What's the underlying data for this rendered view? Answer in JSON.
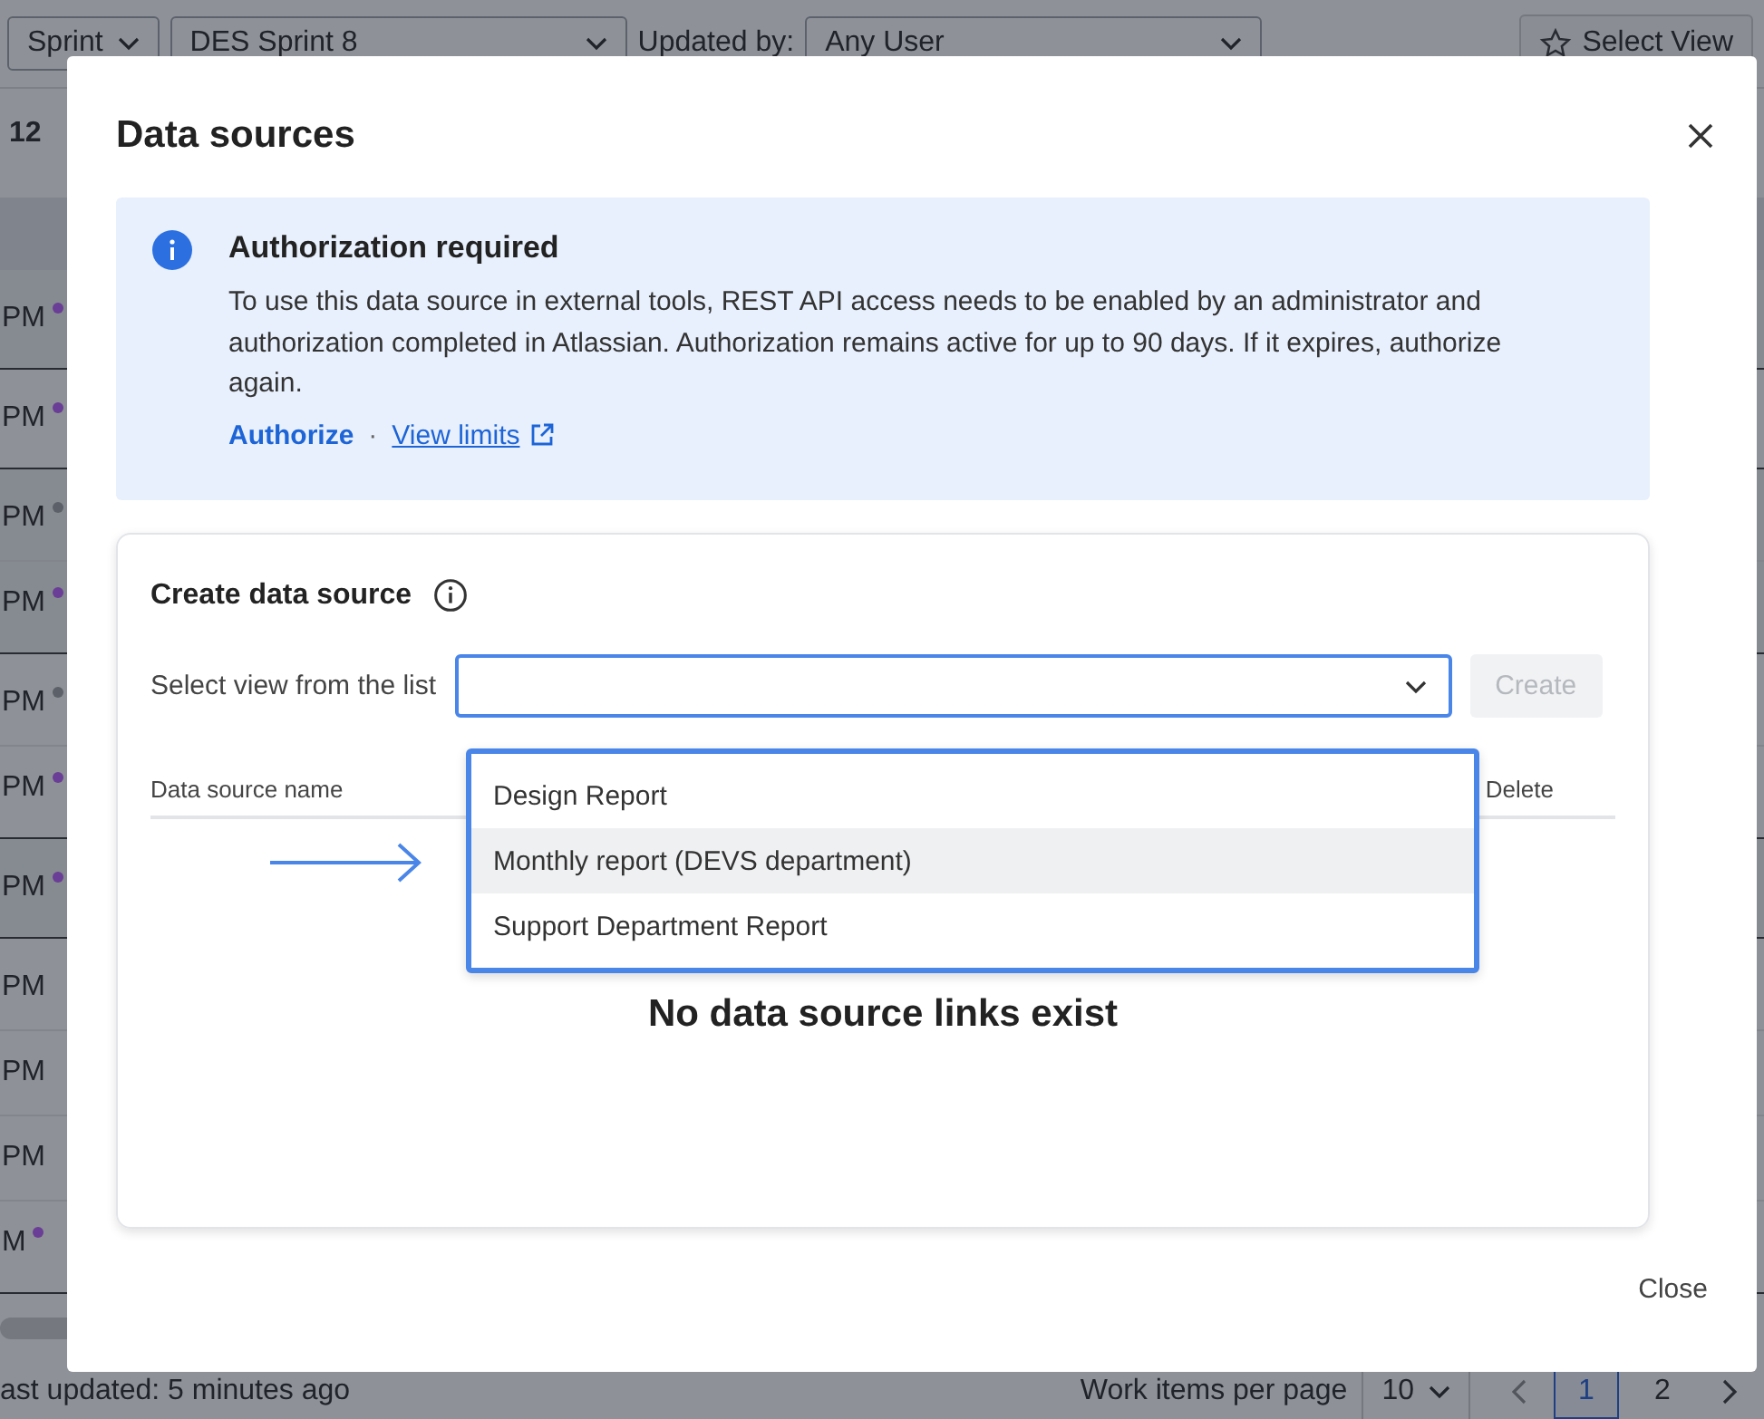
{
  "toolbar": {
    "sprint_filter": "Sprint",
    "sprint_value": "DES Sprint 8",
    "updated_by_label": "Updated by:",
    "updated_by_value": "Any User",
    "select_view_button": "Select View"
  },
  "summary": {
    "count_text": "12"
  },
  "row_groups": [
    {
      "rows": [
        {
          "time": "PM",
          "color": "#6a3d96"
        }
      ]
    },
    {
      "rows": [
        {
          "time": "PM",
          "color": "#6a3d96"
        }
      ]
    },
    {
      "rows": [
        {
          "time": "PM",
          "color": "#5c6068"
        },
        {
          "time": "PM",
          "color": "#6a3d96"
        }
      ]
    },
    {
      "rows": [
        {
          "time": "PM",
          "color": "#5c6068"
        },
        {
          "time": "PM",
          "color": "#6a3d96"
        }
      ]
    },
    {
      "rows": [
        {
          "time": "PM",
          "color": "#6a3d96"
        }
      ]
    },
    {
      "rows": [
        {
          "time": "PM"
        },
        {
          "time": "PM"
        },
        {
          "time": "PM"
        },
        {
          "time": "M",
          "color": "#6a3d96"
        }
      ]
    }
  ],
  "footer": {
    "last_updated": "ast updated: 5 minutes ago",
    "per_page_label": "Work items per page",
    "per_page_value": "10",
    "pages": [
      {
        "label": "1",
        "selected": true
      },
      {
        "label": "2",
        "selected": false
      }
    ]
  },
  "modal": {
    "title": "Data sources",
    "banner": {
      "title": "Authorization required",
      "text": "To use this data source in external tools, REST API access needs to be enabled by an administrator and authorization completed in Atlassian. Authorization remains active for up to 90 days. If it expires, authorize again.",
      "primary_link": "Authorize",
      "separator": "·",
      "secondary_link": "View limits"
    },
    "create": {
      "title": "Create data source",
      "select_label": "Select view from the list",
      "create_button": {
        "label": "Create",
        "disabled": true
      },
      "dropdown": {
        "expanded": true,
        "options": [
          {
            "label": "Design Report",
            "selected": false
          },
          {
            "label": "Monthly report (DEVS department)",
            "selected": true
          },
          {
            "label": "Support Department Report",
            "selected": false
          }
        ]
      },
      "table": {
        "columns": [
          "Data source name",
          "Delete"
        ],
        "empty_text": "No data source links exist"
      }
    },
    "close_button": "Close"
  }
}
